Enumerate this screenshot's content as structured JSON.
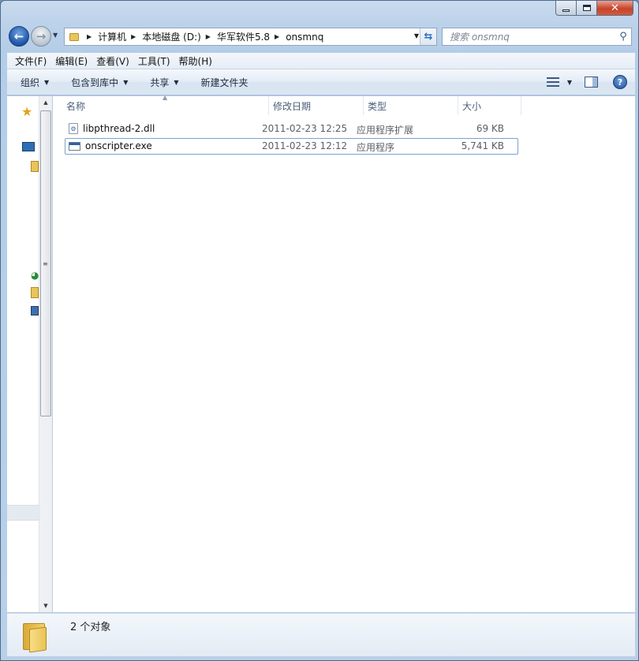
{
  "window": {
    "caption": {
      "minimize": "",
      "maximize": "",
      "close": "✕"
    }
  },
  "nav": {
    "back_glyph": "←",
    "forward_glyph": "→",
    "breadcrumbs": [
      "计算机",
      "本地磁盘 (D:)",
      "华军软件5.8",
      "onsmnq"
    ],
    "search_placeholder": "搜索 onsmnq"
  },
  "menu": [
    "文件(F)",
    "编辑(E)",
    "查看(V)",
    "工具(T)",
    "帮助(H)"
  ],
  "toolbar": {
    "organize": "组织",
    "include_in_library": "包含到库中",
    "share": "共享",
    "new_folder": "新建文件夹",
    "help": "?"
  },
  "columns": {
    "name": "名称",
    "date": "修改日期",
    "type": "类型",
    "size": "大小"
  },
  "files": [
    {
      "name": "libpthread-2.dll",
      "date": "2011-02-23 12:25",
      "type": "应用程序扩展",
      "size": "69 KB",
      "icon": "dll-file-icon"
    },
    {
      "name": "onscripter.exe",
      "date": "2011-02-23 12:12",
      "type": "应用程序",
      "size": "5,741 KB",
      "icon": "exe-file-icon"
    }
  ],
  "status": {
    "count_text": "2 个对象"
  },
  "colors": {
    "chrome": "#bcd2ea",
    "close_red": "#c7432a",
    "focus_border": "#7da2ce"
  }
}
